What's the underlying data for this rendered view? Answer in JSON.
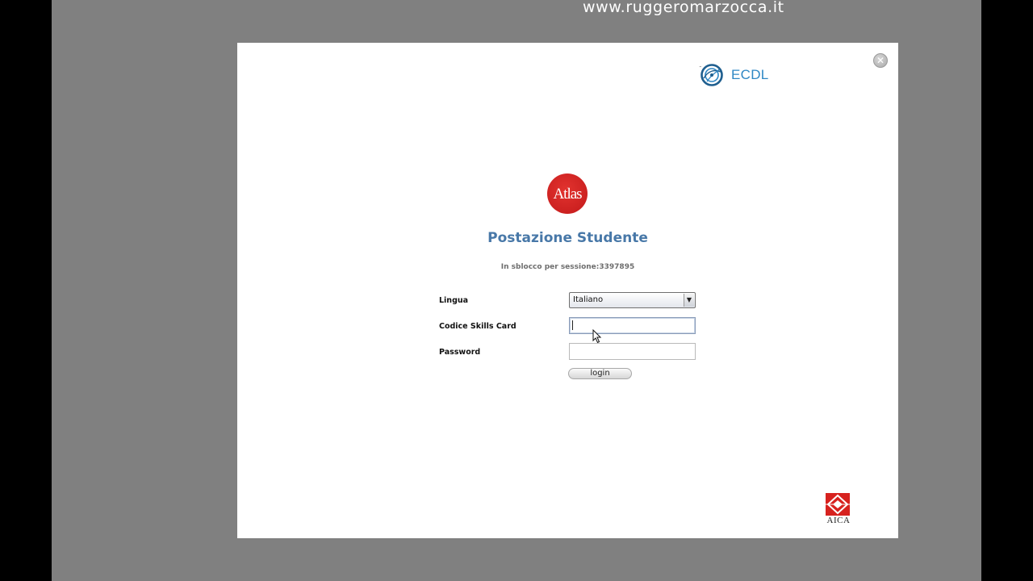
{
  "watermark": "www.ruggeromarzocca.it",
  "dialog": {
    "close_icon": "close-icon",
    "ecdl_logo_text": "ECDL",
    "ecdl_tm": "™",
    "atlas_logo_text": "Atlas",
    "title": "Postazione Studente",
    "session_text": "In sblocco per sessione:3397895",
    "form": {
      "language_label": "Lingua",
      "language_value": "Italiano",
      "skills_card_label": "Codice Skills Card",
      "skills_card_value": "",
      "password_label": "Password",
      "password_value": "",
      "login_label": "login"
    },
    "aica_logo_text": "AICA"
  },
  "colors": {
    "title": "#4878a8",
    "ecdl_brand": "#2e87c4",
    "atlas_red": "#d42624",
    "aica_red": "#d7221f",
    "backdrop": "#808080"
  }
}
